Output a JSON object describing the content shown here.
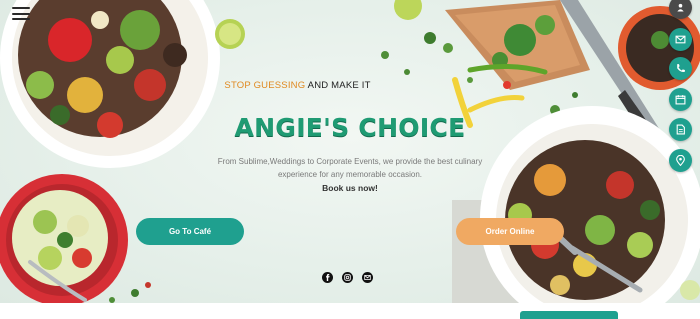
{
  "colors": {
    "accent_teal": "#1fa08f",
    "accent_orange": "#f0a962",
    "title_green": "#1f9b73",
    "tagline_orange": "#e08a22"
  },
  "nav": {
    "menu_icon": "hamburger-icon"
  },
  "hero": {
    "tagline_accent": "STOP GUESSING",
    "tagline_rest": "AND MAKE IT",
    "title": "ANGIE'S CHOICE",
    "description": "From Sublime,Weddings to Corporate Events, we provide the best culinary experience for any memorable occasion.",
    "book": "Book us now!",
    "cafe_button": "Go To Café",
    "order_button": "Order Online"
  },
  "social": [
    "facebook-icon",
    "instagram-icon",
    "email-icon"
  ],
  "side_buttons": [
    "user-icon",
    "mail-icon",
    "phone-icon",
    "calendar-icon",
    "document-icon",
    "location-icon"
  ]
}
